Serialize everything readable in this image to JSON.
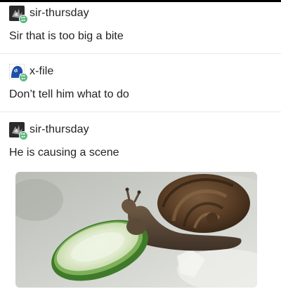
{
  "posts": [
    {
      "username": "sir-thursday",
      "text": "Sir that is too big a bite",
      "avatar_icon": "dark-spiky-avatar-icon"
    },
    {
      "username": "x-file",
      "text": "Don’t tell him what to do",
      "avatar_icon": "blue-face-avatar-icon"
    },
    {
      "username": "sir-thursday",
      "text": "He is causing a scene",
      "avatar_icon": "dark-spiky-avatar-icon"
    }
  ],
  "colors": {
    "reblog_badge": "#5ab77f",
    "divider": "#e9e9e9",
    "text": "#222222"
  }
}
